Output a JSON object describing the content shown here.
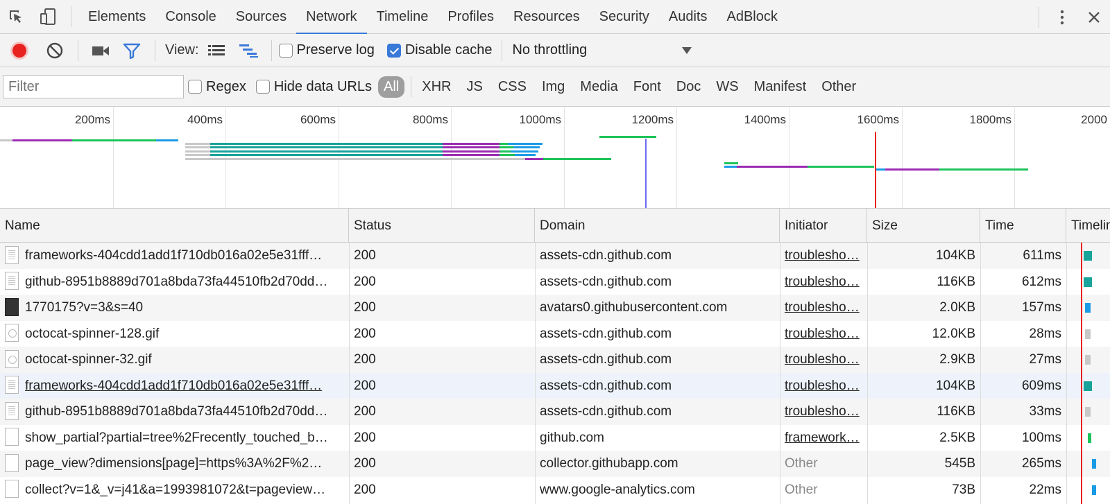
{
  "tabs": [
    "Elements",
    "Console",
    "Sources",
    "Network",
    "Timeline",
    "Profiles",
    "Resources",
    "Security",
    "Audits",
    "AdBlock"
  ],
  "active_tab": "Network",
  "toolbar": {
    "view_label": "View:",
    "preserve_log": "Preserve log",
    "disable_cache": "Disable cache",
    "throttling": "No throttling"
  },
  "filter": {
    "placeholder": "Filter",
    "regex": "Regex",
    "hide_data_urls": "Hide data URLs",
    "types": [
      "All",
      "XHR",
      "JS",
      "CSS",
      "Img",
      "Media",
      "Font",
      "Doc",
      "WS",
      "Manifest",
      "Other"
    ]
  },
  "overview": {
    "ticks": [
      "200ms",
      "400ms",
      "600ms",
      "800ms",
      "1000ms",
      "1200ms",
      "1400ms",
      "1600ms",
      "1800ms",
      "2000"
    ]
  },
  "columns": {
    "name": "Name",
    "status": "Status",
    "domain": "Domain",
    "initiator": "Initiator",
    "size": "Size",
    "time": "Time",
    "timeline": "Timeline"
  },
  "rows": [
    {
      "name": "frameworks-404cdd1add1f710db016a02e5e31fff…",
      "status": "200",
      "domain": "assets-cdn.github.com",
      "initiator": "troublesho…",
      "size": "104KB",
      "time": "611ms"
    },
    {
      "name": "github-8951b8889d701a8bda73fa44510fb2d70dd…",
      "status": "200",
      "domain": "assets-cdn.github.com",
      "initiator": "troublesho…",
      "size": "116KB",
      "time": "612ms"
    },
    {
      "name": "1770175?v=3&s=40",
      "status": "200",
      "domain": "avatars0.githubusercontent.com",
      "initiator": "troublesho…",
      "size": "2.0KB",
      "time": "157ms"
    },
    {
      "name": "octocat-spinner-128.gif",
      "status": "200",
      "domain": "assets-cdn.github.com",
      "initiator": "troublesho…",
      "size": "12.0KB",
      "time": "28ms"
    },
    {
      "name": "octocat-spinner-32.gif",
      "status": "200",
      "domain": "assets-cdn.github.com",
      "initiator": "troublesho…",
      "size": "2.9KB",
      "time": "27ms"
    },
    {
      "name": "frameworks-404cdd1add1f710db016a02e5e31fff…",
      "status": "200",
      "domain": "assets-cdn.github.com",
      "initiator": "troublesho…",
      "size": "104KB",
      "time": "609ms"
    },
    {
      "name": "github-8951b8889d701a8bda73fa44510fb2d70dd…",
      "status": "200",
      "domain": "assets-cdn.github.com",
      "initiator": "troublesho…",
      "size": "116KB",
      "time": "33ms"
    },
    {
      "name": "show_partial?partial=tree%2Frecently_touched_b…",
      "status": "200",
      "domain": "github.com",
      "initiator": "framework…",
      "size": "2.5KB",
      "time": "100ms"
    },
    {
      "name": "page_view?dimensions[page]=https%3A%2F%2…",
      "status": "200",
      "domain": "collector.githubapp.com",
      "initiator": "Other",
      "size": "545B",
      "time": "265ms"
    },
    {
      "name": "collect?v=1&_v=j41&a=1993981072&t=pageview…",
      "status": "200",
      "domain": "www.google-analytics.com",
      "initiator": "Other",
      "size": "73B",
      "time": "22ms"
    }
  ],
  "colors": {
    "accent": "#3879d9",
    "record": "#e8221f",
    "waiting": "#1ec45a",
    "download": "#1b9be6",
    "stalled": "#9c2cb3"
  }
}
